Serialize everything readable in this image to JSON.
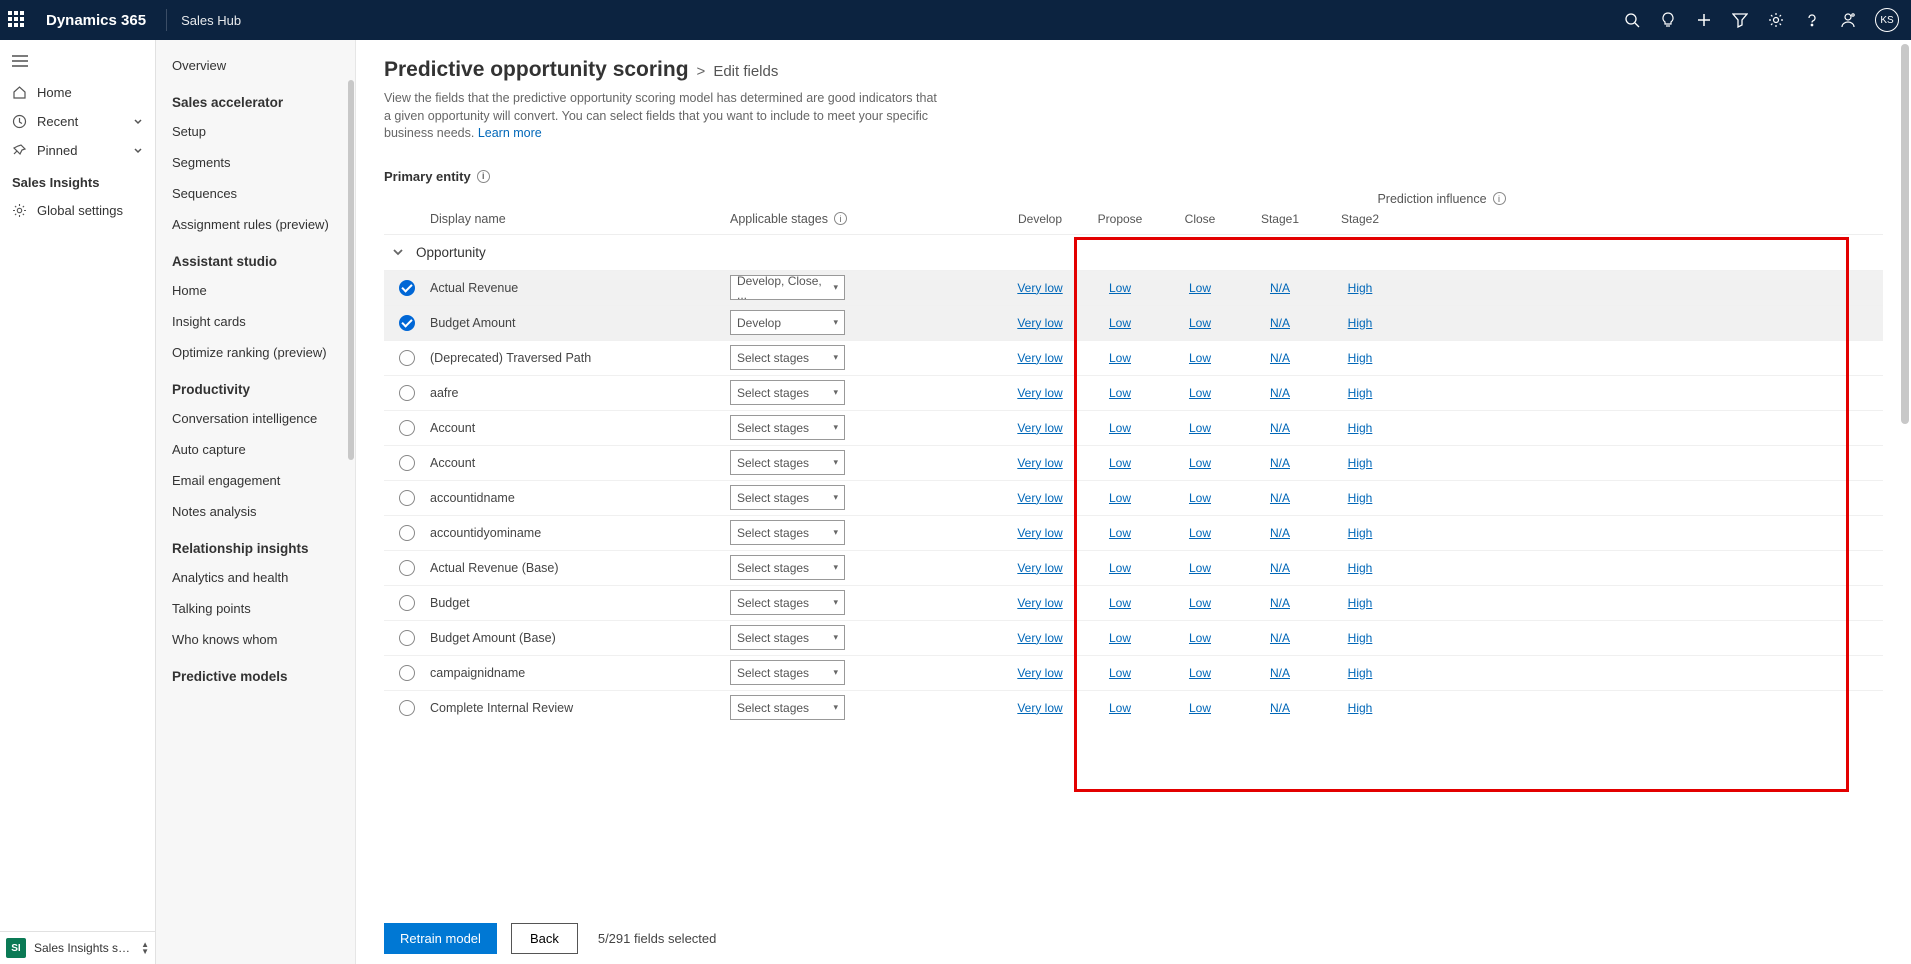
{
  "topbar": {
    "brand": "Dynamics 365",
    "hub": "Sales Hub",
    "avatar": "KS"
  },
  "nav1": {
    "home": "Home",
    "recent": "Recent",
    "pinned": "Pinned",
    "section": "Sales Insights",
    "global_settings": "Global settings",
    "bottom_label": "Sales Insights sett..."
  },
  "nav2": {
    "overview": "Overview",
    "sales_accel": "Sales accelerator",
    "setup": "Setup",
    "segments": "Segments",
    "sequences": "Sequences",
    "assignment": "Assignment rules (preview)",
    "assistant": "Assistant studio",
    "home": "Home",
    "insight": "Insight cards",
    "optimize": "Optimize ranking (preview)",
    "productivity": "Productivity",
    "conv": "Conversation intelligence",
    "auto": "Auto capture",
    "email": "Email engagement",
    "notes": "Notes analysis",
    "rel": "Relationship insights",
    "analytics": "Analytics and health",
    "talking": "Talking points",
    "who": "Who knows whom",
    "predictive": "Predictive models"
  },
  "page": {
    "title": "Predictive opportunity scoring",
    "breadcrumb": "Edit fields",
    "desc": "View the fields that the predictive opportunity scoring model has determined are good indicators that a given opportunity will convert. You can select fields that you want to include to meet your specific business needs.",
    "learn_more": "Learn more",
    "primary_entity": "Primary entity"
  },
  "table": {
    "col_display": "Display name",
    "col_stages": "Applicable stages",
    "col_influence": "Prediction influence",
    "stages": [
      "Develop",
      "Propose",
      "Close",
      "Stage1",
      "Stage2"
    ],
    "entity": "Opportunity",
    "rows": [
      {
        "sel": true,
        "name": "Actual Revenue",
        "stage": "Develop, Close, ...",
        "i": [
          "Very low",
          "Low",
          "Low",
          "N/A",
          "High"
        ]
      },
      {
        "sel": true,
        "name": "Budget Amount",
        "stage": "Develop",
        "i": [
          "Very low",
          "Low",
          "Low",
          "N/A",
          "High"
        ]
      },
      {
        "sel": false,
        "name": "(Deprecated) Traversed Path",
        "stage": "Select stages",
        "i": [
          "Very low",
          "Low",
          "Low",
          "N/A",
          "High"
        ]
      },
      {
        "sel": false,
        "name": "aafre",
        "stage": "Select stages",
        "i": [
          "Very low",
          "Low",
          "Low",
          "N/A",
          "High"
        ]
      },
      {
        "sel": false,
        "name": "Account",
        "stage": "Select stages",
        "i": [
          "Very low",
          "Low",
          "Low",
          "N/A",
          "High"
        ]
      },
      {
        "sel": false,
        "name": "Account",
        "stage": "Select stages",
        "i": [
          "Very low",
          "Low",
          "Low",
          "N/A",
          "High"
        ]
      },
      {
        "sel": false,
        "name": "accountidname",
        "stage": "Select stages",
        "i": [
          "Very low",
          "Low",
          "Low",
          "N/A",
          "High"
        ]
      },
      {
        "sel": false,
        "name": "accountidyominame",
        "stage": "Select stages",
        "i": [
          "Very low",
          "Low",
          "Low",
          "N/A",
          "High"
        ]
      },
      {
        "sel": false,
        "name": "Actual Revenue (Base)",
        "stage": "Select stages",
        "i": [
          "Very low",
          "Low",
          "Low",
          "N/A",
          "High"
        ]
      },
      {
        "sel": false,
        "name": "Budget",
        "stage": "Select stages",
        "i": [
          "Very low",
          "Low",
          "Low",
          "N/A",
          "High"
        ]
      },
      {
        "sel": false,
        "name": "Budget Amount (Base)",
        "stage": "Select stages",
        "i": [
          "Very low",
          "Low",
          "Low",
          "N/A",
          "High"
        ]
      },
      {
        "sel": false,
        "name": "campaignidname",
        "stage": "Select stages",
        "i": [
          "Very low",
          "Low",
          "Low",
          "N/A",
          "High"
        ]
      },
      {
        "sel": false,
        "name": "Complete Internal Review",
        "stage": "Select stages",
        "i": [
          "Very low",
          "Low",
          "Low",
          "N/A",
          "High"
        ]
      }
    ]
  },
  "footer": {
    "retrain": "Retrain model",
    "back": "Back",
    "count": "5/291 fields selected"
  }
}
